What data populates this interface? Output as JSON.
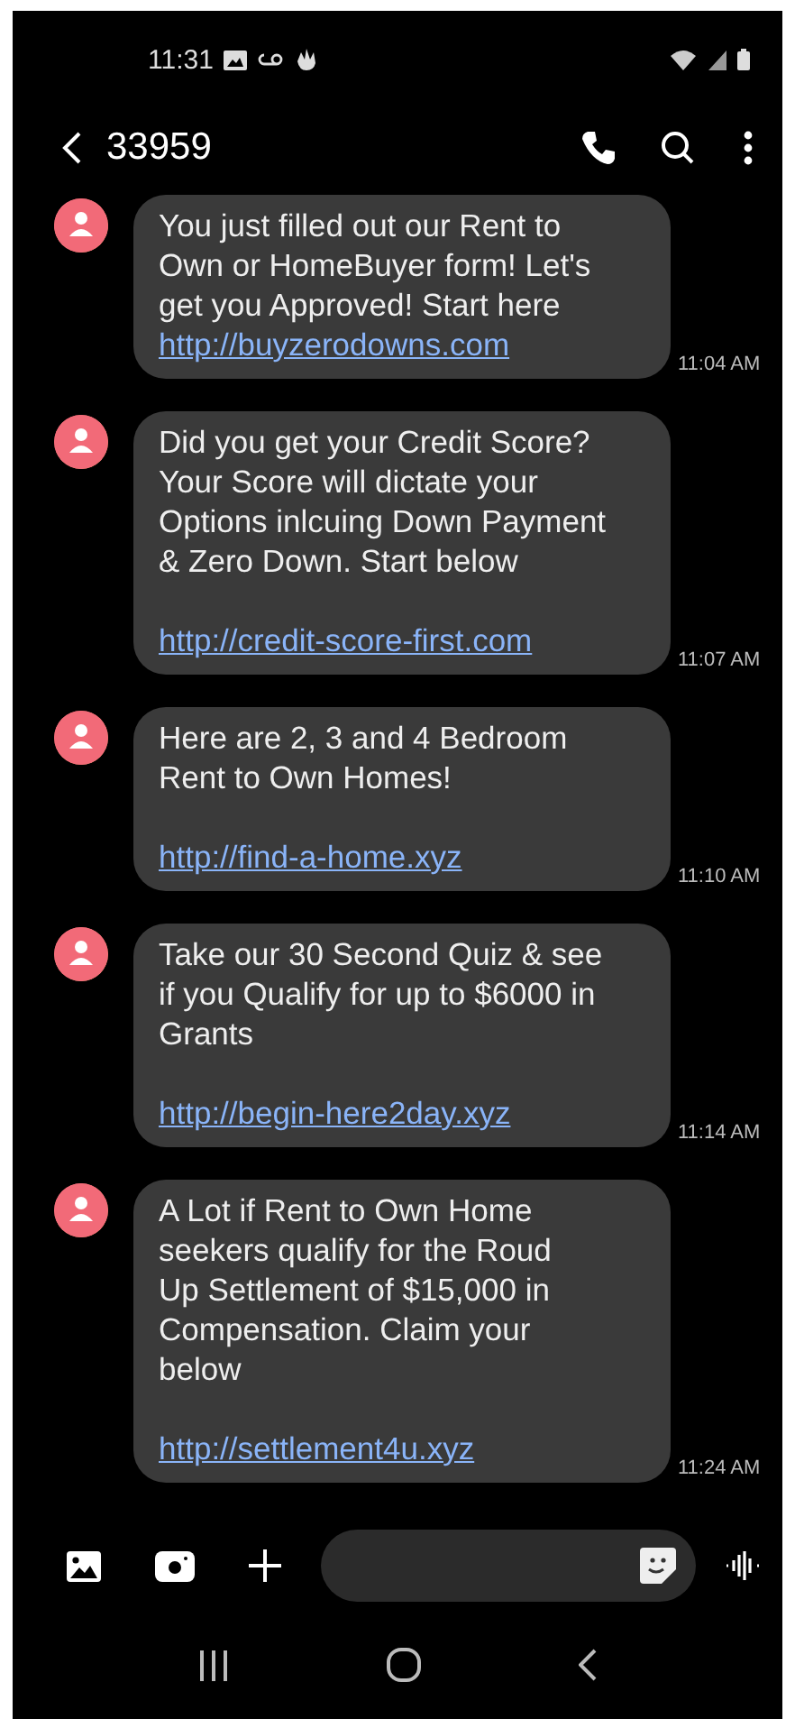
{
  "status_bar": {
    "time": "11:31"
  },
  "header": {
    "title": "33959"
  },
  "messages": [
    {
      "text": "You just filled out our Rent to\nOwn or HomeBuyer form! Let's\nget you Approved! Start here",
      "link": "http://buyzerodowns.com",
      "spaced_link": false,
      "time": "11:04 AM"
    },
    {
      "text": "Did you get your Credit Score?\nYour Score will dictate your\nOptions inlcuing Down Payment\n& Zero Down. Start below",
      "link": "http://credit-score-first.com",
      "spaced_link": true,
      "time": "11:07 AM"
    },
    {
      "text": "Here are 2, 3 and 4 Bedroom\nRent to Own Homes!",
      "link": "http://find-a-home.xyz",
      "spaced_link": true,
      "time": "11:10 AM"
    },
    {
      "text": "Take our 30 Second Quiz & see\nif you Qualify for up to $6000 in\nGrants",
      "link": "http://begin-here2day.xyz",
      "spaced_link": true,
      "time": "11:14 AM"
    },
    {
      "text": "A Lot if Rent to Own Home\nseekers qualify for the Roud\nUp Settlement of $15,000 in\nCompensation. Claim your\nbelow",
      "link": "http://settlement4u.xyz",
      "spaced_link": true,
      "time": "11:24 AM"
    }
  ]
}
